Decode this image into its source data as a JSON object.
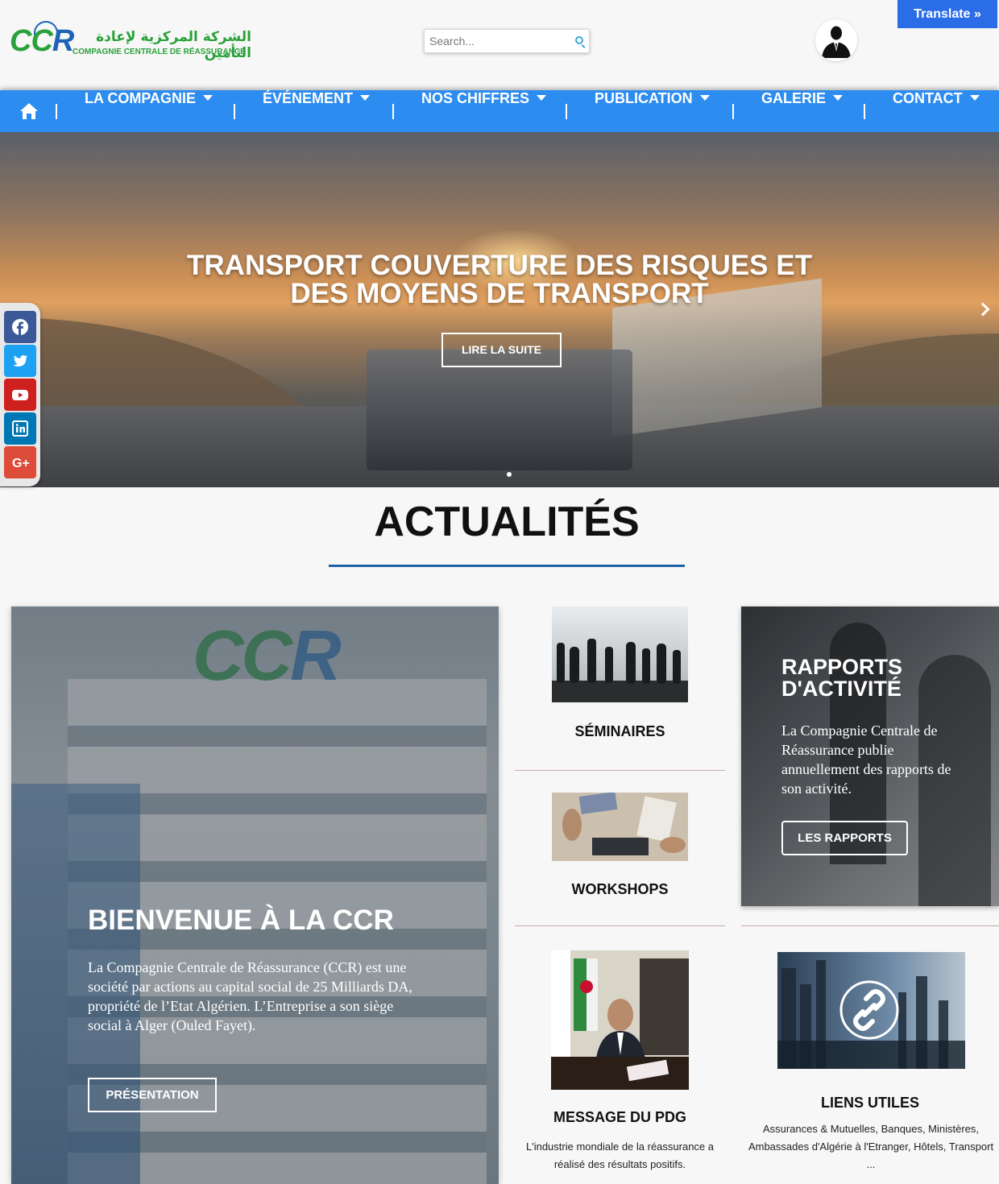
{
  "header": {
    "logo_text": "CCR",
    "logo_arabic": "الشركة المركزية لإعادة التأمين",
    "logo_french": "COMPAGNIE CENTRALE DE RÉASSURANCE",
    "search_placeholder": "Search...",
    "translate_label": "Translate »"
  },
  "nav": {
    "items": [
      {
        "label": "LA COMPAGNIE"
      },
      {
        "label": "ÉVÉNEMENT"
      },
      {
        "label": "NOS CHIFFRES"
      },
      {
        "label": "PUBLICATION"
      },
      {
        "label": "GALERIE"
      },
      {
        "label": "CONTACT"
      }
    ]
  },
  "hero": {
    "title_line1": "TRANSPORT COUVERTURE DES RISQUES ET",
    "title_line2": "DES MOYENS DE TRANSPORT",
    "button_label": "LIRE LA SUITE"
  },
  "social": {
    "icons": [
      "facebook-icon",
      "twitter-icon",
      "youtube-icon",
      "linkedin-icon",
      "google-plus-icon"
    ],
    "colors": {
      "facebook": "#3b5998",
      "twitter": "#1da1f2",
      "youtube": "#cd201f",
      "linkedin": "#0077b5",
      "google_plus": "#dd4b39"
    }
  },
  "section": {
    "title": "ACTUALITÉS",
    "accent_color": "#1f5fa8"
  },
  "welcome": {
    "title": "BIENVENUE À LA CCR",
    "text": "La Compagnie Centrale de Réassurance (CCR) est une société par actions au capital social de 25 Milliards DA, propriété de l’Etat Algérien. L’Entreprise a son siège social à Alger (Ouled Fayet).",
    "button_label": "PRÉSENTATION"
  },
  "middle": {
    "seminaires_label": "SÉMINAIRES",
    "workshops_label": "WORKSHOPS",
    "pdg_label": "MESSAGE DU PDG",
    "pdg_text": "L'industrie mondiale de la réassurance a réalisé des résultats positifs."
  },
  "rapports": {
    "title": "RAPPORTS D'ACTIVITÉ",
    "text": "La Compagnie Centrale de Réassurance publie annuellement des rapports de son activité.",
    "button_label": "LES RAPPORTS"
  },
  "liens": {
    "label": "LIENS UTILES",
    "text": "Assurances & Mutuelles, Banques, Ministères, Ambassades d'Algérie à l'Etranger, Hôtels, Transport ..."
  },
  "colors": {
    "nav_bg": "#2d8cf0",
    "translate_bg": "#2b6de6",
    "logo_green": "#2aa13a",
    "logo_blue": "#1f63b8"
  }
}
